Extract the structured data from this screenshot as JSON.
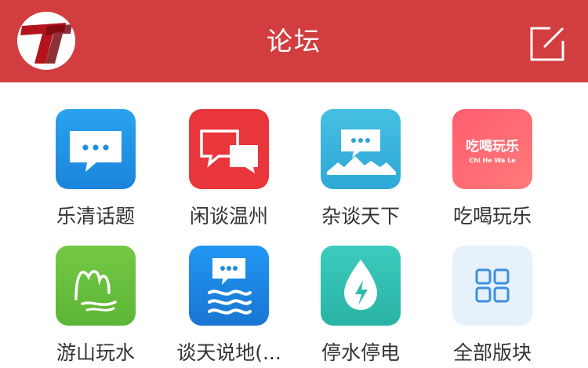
{
  "header": {
    "title": "论坛",
    "background": "#d23d3f",
    "logo_icon": "brand-logo-icon",
    "compose_icon": "compose-icon"
  },
  "forums": [
    {
      "label": "乐清话题",
      "icon": "chat-bubble-icon",
      "color": "#2596e8"
    },
    {
      "label": "闲谈温州",
      "icon": "two-chat-bubbles-icon",
      "color": "#e8363b"
    },
    {
      "label": "杂谈天下",
      "icon": "mountain-chat-icon",
      "color": "#3fb6dc"
    },
    {
      "label": "吃喝玩乐",
      "icon": "chi-he-wan-le-icon",
      "color": "#ff6673",
      "tile_text": "吃喝玩乐",
      "tile_subtext": "Chi He Wa Le"
    },
    {
      "label": "游山玩水",
      "icon": "hills-river-icon",
      "color": "#6cc23d"
    },
    {
      "label": "谈天说地(...",
      "icon": "chat-waves-icon",
      "color": "#1e88e5"
    },
    {
      "label": "停水停电",
      "icon": "water-drop-bolt-icon",
      "color": "#33c2b3"
    },
    {
      "label": "全部版块",
      "icon": "grid-squares-icon",
      "color": "#e6f1fb"
    }
  ]
}
